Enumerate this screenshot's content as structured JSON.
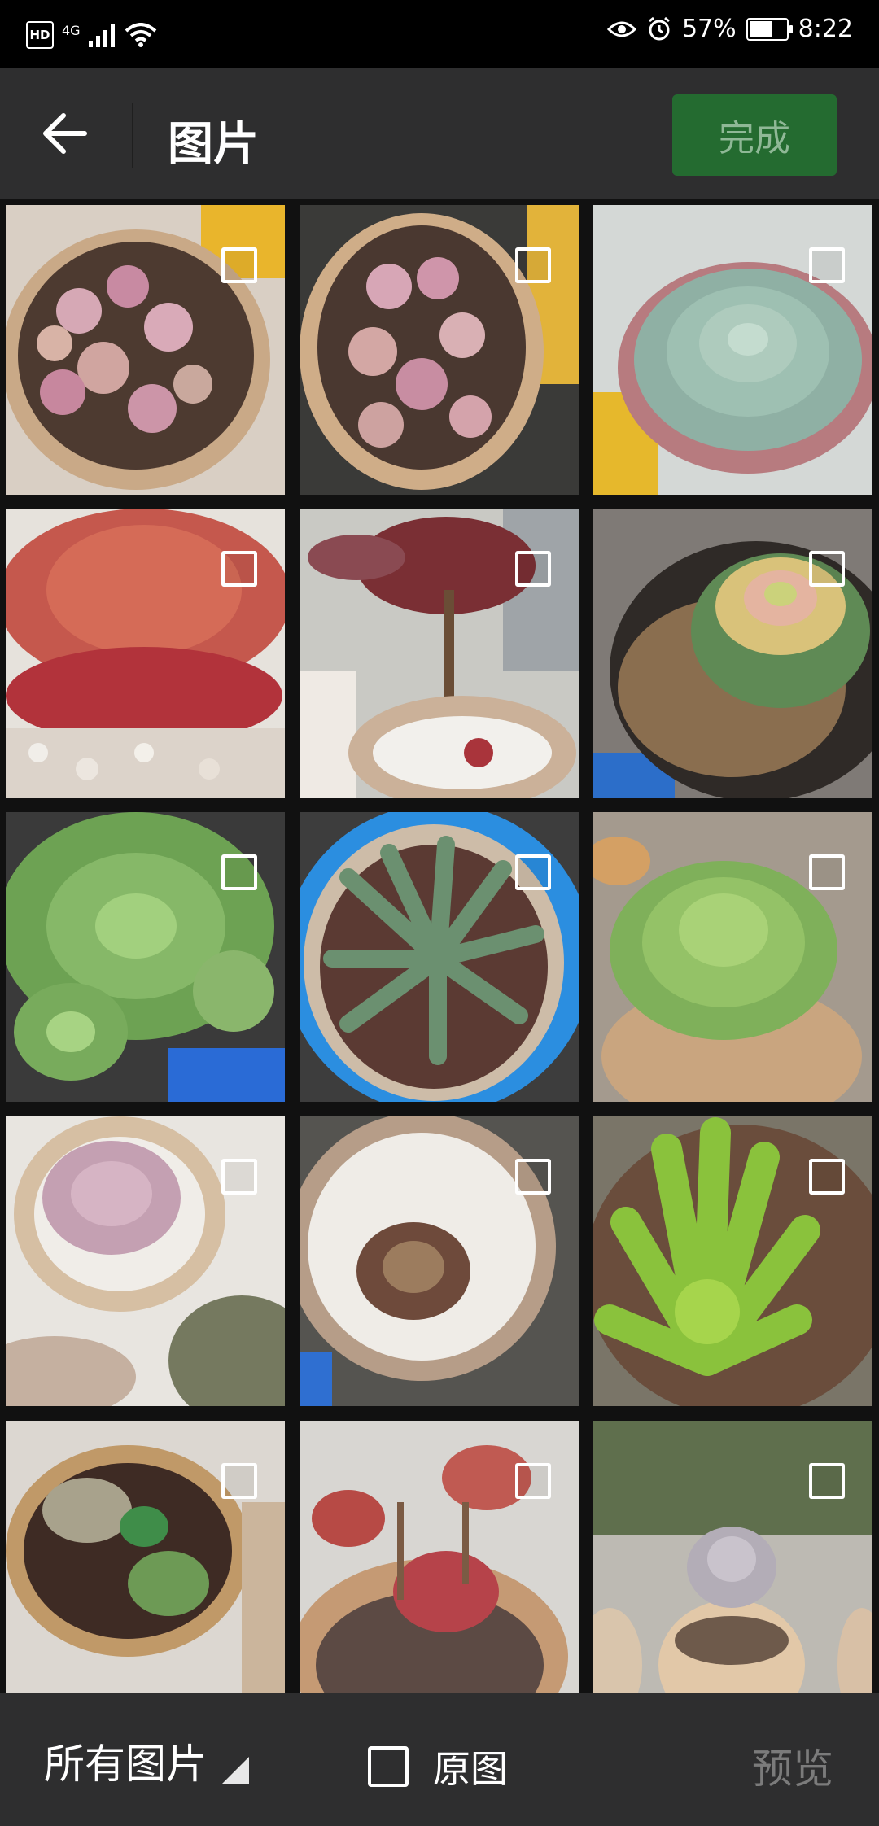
{
  "status_bar": {
    "hd": "HD",
    "network": "4G",
    "battery_percent": "57%",
    "battery_level": 0.57,
    "time": "8:22"
  },
  "header": {
    "title": "图片",
    "done_label": "完成"
  },
  "photos": [
    {
      "name": "pink-succulents-pot-1",
      "selected": false
    },
    {
      "name": "pink-succulents-pot-2",
      "selected": false
    },
    {
      "name": "blue-green-echeveria",
      "selected": false
    },
    {
      "name": "red-succulent-cluster",
      "selected": false
    },
    {
      "name": "tall-red-succulent",
      "selected": false
    },
    {
      "name": "yellow-pink-echeveria",
      "selected": false
    },
    {
      "name": "green-aeonium",
      "selected": false
    },
    {
      "name": "haworthia-blue-pot",
      "selected": false
    },
    {
      "name": "green-echeveria",
      "selected": false
    },
    {
      "name": "pink-graptopetalum",
      "selected": false
    },
    {
      "name": "brown-echeveria-white-pebbles",
      "selected": false
    },
    {
      "name": "green-sedum",
      "selected": false
    },
    {
      "name": "mixed-succulent-pot",
      "selected": false
    },
    {
      "name": "red-echeveria-pot",
      "selected": false
    },
    {
      "name": "grey-succulent-outdoor",
      "selected": false
    }
  ],
  "footer": {
    "album_label": "所有图片",
    "original_label": "原图",
    "preview_label": "预览"
  },
  "colors": {
    "accent_green": "#246b30",
    "bar_bg": "#2e2e2f",
    "grid_bg": "#111111"
  }
}
